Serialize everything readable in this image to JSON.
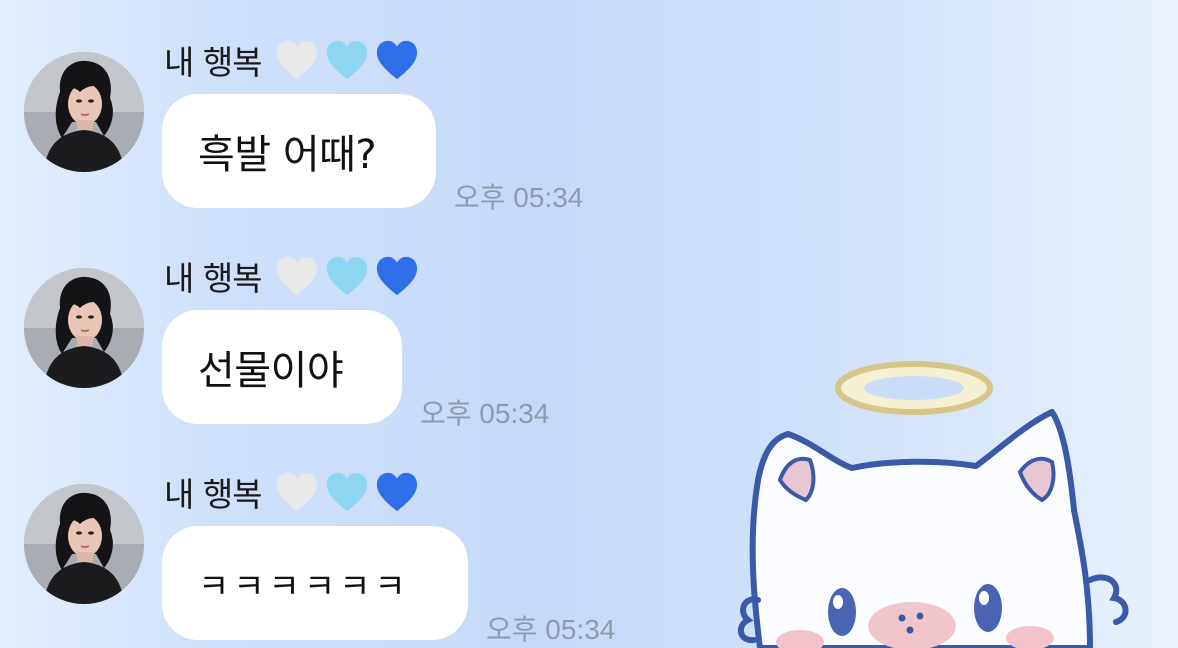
{
  "colors": {
    "bubble": "#ffffff",
    "timestamp": "#8f9bab",
    "heart_white": "#e8e8e8",
    "heart_light_blue": "#8fd6f5",
    "heart_blue": "#2f6fe8"
  },
  "messages": [
    {
      "sender": "내 행복",
      "hearts": [
        "white-heart-icon",
        "light-blue-heart-icon",
        "blue-heart-icon"
      ],
      "text": "흑발 어때?",
      "time": "오후 05:34"
    },
    {
      "sender": "내 행복",
      "hearts": [
        "white-heart-icon",
        "light-blue-heart-icon",
        "blue-heart-icon"
      ],
      "text": "선물이야",
      "time": "오후 05:34"
    },
    {
      "sender": "내 행복",
      "hearts": [
        "white-heart-icon",
        "light-blue-heart-icon",
        "blue-heart-icon"
      ],
      "text": "ㅋㅋㅋㅋㅋㅋ",
      "time": "오후 05:34"
    }
  ]
}
